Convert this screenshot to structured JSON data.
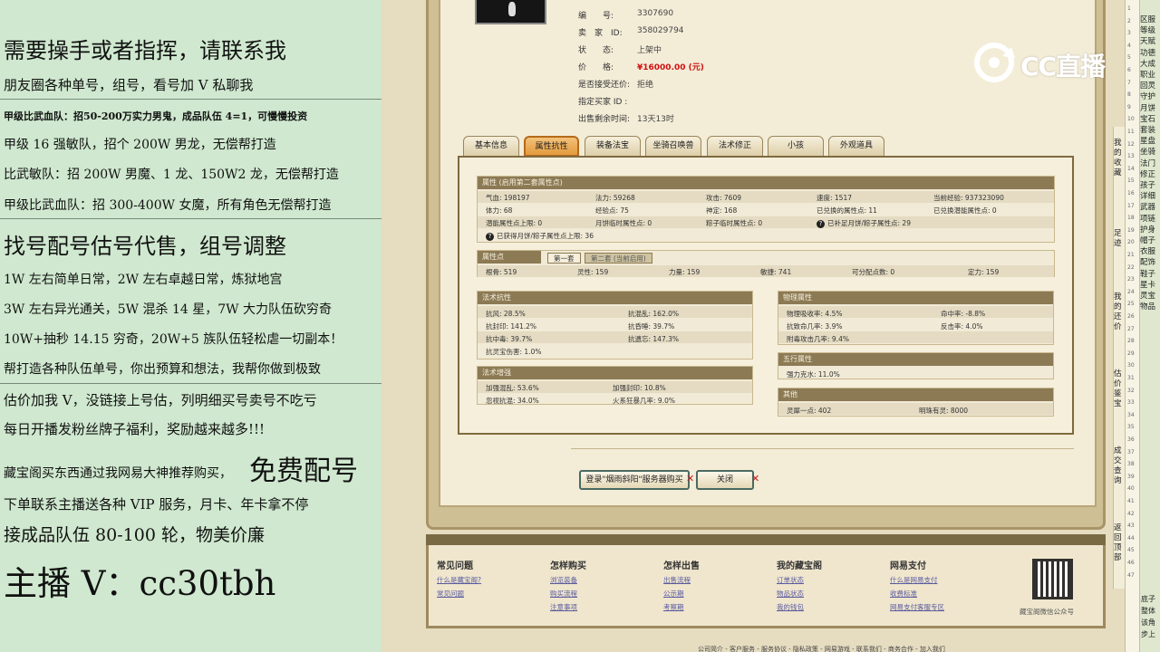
{
  "stream_overlay": {
    "lines": [
      "需要操手或者指挥，请联系我",
      "朋友圈各种单号，组号，看号加 V 私聊我",
      "甲级比武血队：招50-200万实力男鬼，成品队伍 4=1，可慢慢投资",
      "甲级 16 强敏队，招个 200W 男龙，无偿帮打造",
      "比武敏队：招 200W 男魔、1 龙、150W2 龙，无偿帮打造",
      "甲级比武血队：招 300-400W 女魔，所有角色无偿帮打造",
      "找号配号估号代售，组号调整",
      "1W 左右简单日常，2W 左右卓越日常，炼狱地宫",
      "3W 左右异光通关，5W 混杀 14 星，7W 大力队伍砍穷奇",
      "10W+抽秒 14.15 穷奇，20W+5 族队伍轻松虐一切副本！",
      "帮打造各种队伍单号，你出预算和想法，我帮你做到极致",
      "估价加我 V，没链接上号估，列明细买号卖号不吃亏",
      "每日开播发粉丝牌子福利，奖励越来越多!!!",
      "藏宝阁买东西通过我网易大神推荐购买，",
      "免费配号",
      "下单联系主播送各种 VIP 服务，月卡、年卡拿不停",
      "接成品队伍 80-100 轮，物美价廉",
      "主播 V：cc30tbh"
    ]
  },
  "item": {
    "meta": [
      {
        "label": "编　　号:",
        "value": "3307690"
      },
      {
        "label": "卖　家　ID:",
        "value": "358029794"
      },
      {
        "label": "状　　态:",
        "value": "上架中"
      },
      {
        "label": "价　　格:",
        "value": "¥16000.00 (元)"
      },
      {
        "label": "是否接受还价:",
        "value": "拒绝"
      },
      {
        "label": "指定买家 ID :",
        "value": ""
      },
      {
        "label": "出售剩余时间:",
        "value": "13天13时"
      }
    ],
    "price_color": "#d01010"
  },
  "tabs": [
    "基本信息",
    "属性抗性",
    "装备法宝",
    "坐骑召唤兽",
    "法术修正",
    "小孩",
    "外观道具"
  ],
  "attributes": {
    "title": "属性 (启用第二套属性点)",
    "rows": [
      [
        "气血: 198197",
        "法力: 59268",
        "攻击: 7609",
        "速度: 1517",
        "当前经验: 937323090"
      ],
      [
        "体力: 68",
        "经验点: 75",
        "神定: 168",
        "已兑换的属性点: 11",
        "已兑换潜能属性点: 0"
      ],
      [
        "潜能属性点上限: 0",
        "月饼临时属性点: 0",
        "粽子临时属性点: 0",
        "已补足月饼/粽子属性点: 29",
        ""
      ]
    ],
    "note": "已获得月饼/粽子属性点上限: 36"
  },
  "points": {
    "title": "属性点",
    "subtabs": [
      "第一套",
      "第二套 (当前启用)"
    ],
    "row": [
      "根骨: 519",
      "灵性: 159",
      "力量: 159",
      "敏捷: 741",
      "可分配点数: 0",
      "定力: 159"
    ]
  },
  "spell_resist": {
    "title": "法术抗性",
    "rows": [
      [
        "抗风: 28.5%",
        "抗混乱: 162.0%"
      ],
      [
        "抗封印: 141.2%",
        "抗昏睡: 39.7%"
      ],
      [
        "抗中毒: 39.7%",
        "抗遗忘: 147.3%"
      ],
      [
        "抗灵宝伤害: 1.0%",
        ""
      ]
    ]
  },
  "spell_boost": {
    "title": "法术增强",
    "rows": [
      [
        "加强混乱: 53.6%",
        "加强封印: 10.8%"
      ],
      [
        "忽视抗混: 34.0%",
        "火系狂暴几率: 9.0%"
      ]
    ]
  },
  "physical": {
    "title": "物理属性",
    "rows": [
      [
        "物理吸收率: 4.5%",
        "命中率: -8.8%"
      ],
      [
        "抗致命几率: 3.9%",
        "反击率: 4.0%"
      ],
      [
        "附毒攻击几率: 9.4%",
        ""
      ]
    ]
  },
  "five_elements": {
    "title": "五行属性",
    "rows": [
      [
        "强力克水: 11.0%"
      ]
    ]
  },
  "other": {
    "title": "其他",
    "rows": [
      [
        "灵犀一点: 402",
        "明珠有灵: 8000"
      ]
    ]
  },
  "buttons": {
    "login": "登录\"烟雨斜阳\"服务器购买",
    "close": "关闭",
    "x": "✕"
  },
  "footer": {
    "columns": [
      {
        "head": "常见问题",
        "links": [
          "什么是藏宝阁?",
          "常见问题"
        ]
      },
      {
        "head": "怎样购买",
        "links": [
          "浏览装备",
          "购买流程",
          "注意事项"
        ]
      },
      {
        "head": "怎样出售",
        "links": [
          "出售流程",
          "公示期",
          "考察期"
        ]
      },
      {
        "head": "我的藏宝阁",
        "links": [
          "订单状态",
          "物品状态",
          "我的钱包"
        ]
      },
      {
        "head": "网易支付",
        "links": [
          "什么是网易支付",
          "收费标准",
          "网易支付客服专区"
        ]
      }
    ],
    "qr_label": "藏宝阁微信公众号",
    "bottom_links": "公司简介 - 客户服务 - 服务协议 - 隐私政策 - 网易游戏 - 联系我们 - 商务合作 - 加入我们"
  },
  "watermark": {
    "text": "CC直播"
  },
  "right_strips": {
    "a_text": [
      "我的收藏",
      "足迹",
      "我的还价",
      "估价鉴宝",
      "成交查询",
      "返回顶部"
    ],
    "b_items": [
      "区服",
      "等级",
      "天赋",
      "功德",
      "大成",
      "职业",
      "回灵",
      "守护",
      "月饼",
      "宝石",
      "套装",
      "星盘",
      "坐骑",
      "法门",
      "修正",
      "孩子",
      "详细",
      "武器",
      "项链",
      "护身",
      "帽子",
      "衣服",
      "配饰",
      "鞋子",
      "星卡",
      "灵宝",
      "物品"
    ],
    "c_items": [
      "1",
      "2",
      "3",
      "4",
      "5",
      "6",
      "7",
      "8",
      "9",
      "10",
      "11",
      "12",
      "13",
      "14",
      "15",
      "16",
      "17",
      "18",
      "19",
      "20",
      "21",
      "22",
      "23",
      "24",
      "25",
      "26",
      "27",
      "28",
      "29",
      "30",
      "31",
      "32",
      "33",
      "34",
      "35",
      "36",
      "37",
      "38",
      "39",
      "40",
      "41",
      "42",
      "43",
      "44",
      "45",
      "46",
      "47"
    ],
    "bottom_text": [
      "底子",
      "整体",
      "该角",
      "步上"
    ]
  }
}
